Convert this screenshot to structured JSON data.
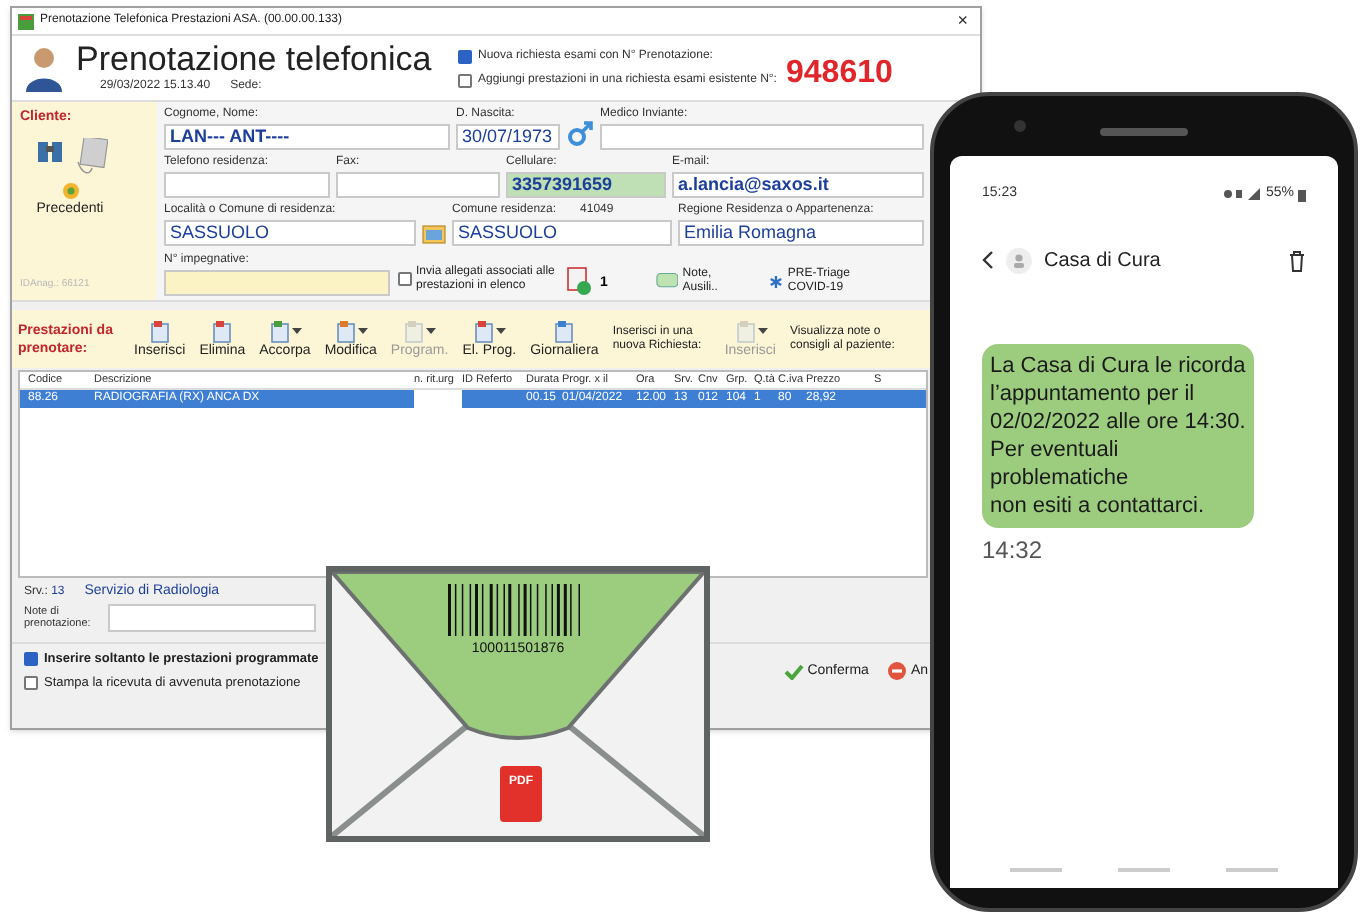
{
  "window": {
    "title": "Prenotazione Telefonica Prestazioni ASA. (00.00.00.133)",
    "close": "×"
  },
  "header": {
    "title": "Prenotazione telefonica",
    "datetime": "29/03/2022 15.13.40",
    "sede_label": "Sede:",
    "options": [
      {
        "label": "Nuova richiesta esami con N° Prenotazione:",
        "checked": true
      },
      {
        "label": "Aggiungi prestazioni in una richiesta esami esistente N°:",
        "checked": false
      }
    ],
    "number": "948610"
  },
  "client": {
    "label": "Cliente:",
    "history_label": "Precedenti",
    "id_label": "IDAnag.: 66121",
    "fields": [
      {
        "label": "Cognome, Nome:",
        "value": "LAN--- ANT----",
        "kind": "bold"
      },
      {
        "label": "D. Nascita:",
        "value": "30/07/1973",
        "kind": "plain"
      },
      {
        "label": "Medico Inviante:",
        "kind": "plain"
      },
      {
        "label": "Telefono residenza:",
        "kind": "plain"
      },
      {
        "label": "Fax:",
        "kind": "plain"
      },
      {
        "label": "Cellulare:",
        "value": "3357391659",
        "kind": "highlight"
      },
      {
        "label": "E-mail:",
        "value": "a.lancia@saxos.it",
        "kind": "bold"
      },
      {
        "label": "Località o Comune di residenza:",
        "value": "SASSUOLO",
        "kind": "plain"
      },
      {
        "label": "Comune residenza:",
        "code": "41049",
        "value": "SASSUOLO",
        "kind": "plain"
      },
      {
        "label": "Regione Residenza o Appartenenza:",
        "value": "Emilia Romagna",
        "kind": "plain"
      },
      {
        "label": "N° impegnative:",
        "kind": "required"
      }
    ],
    "attach": {
      "label": "Invia allegati associati alle prestazioni in elenco",
      "checked": false,
      "count": "1"
    },
    "notes_button": "Note, Ausili..",
    "triage_button": "PRE-Triage COVID-19"
  },
  "toolbar": {
    "label": "Prestazioni da prenotare:",
    "buttons": [
      {
        "label": "Inserisci",
        "disabled": false,
        "dropdown": false
      },
      {
        "label": "Elimina",
        "disabled": false,
        "dropdown": false
      },
      {
        "label": "Accorpa",
        "disabled": false,
        "dropdown": true
      },
      {
        "label": "Modifica",
        "disabled": false,
        "dropdown": true
      },
      {
        "label": "Program.",
        "disabled": true,
        "dropdown": true
      },
      {
        "label": "El. Prog.",
        "disabled": false,
        "dropdown": true
      },
      {
        "label": "Giornaliera",
        "disabled": false,
        "dropdown": false
      }
    ],
    "new_request_label": "Inserisci in una nuova Richiesta:",
    "new_request_button": {
      "label": "Inserisci",
      "disabled": true,
      "dropdown": true
    },
    "advice_label": "Visualizza note o consigli al paziente:"
  },
  "table": {
    "columns": [
      "Codice",
      "Descrizione",
      "n. rit.",
      "urg",
      "ID Referto",
      "Durata",
      "Progr. x il",
      "Ora",
      "Srv.",
      "Cnv",
      "Grp.",
      "Q.tà",
      "C.iva",
      "Prezzo",
      "S"
    ],
    "rows": [
      {
        "selected": true,
        "cells": [
          "88.26",
          "RADIOGRAFIA (RX) ANCA DX",
          null,
          null,
          null,
          "00.15",
          "01/04/2022",
          "12.00",
          "13",
          "012",
          "104",
          "1",
          "80",
          "28,92",
          null
        ]
      }
    ]
  },
  "service": {
    "label": "Srv.:",
    "code": "13",
    "name": "Servizio di Radiologia"
  },
  "booking_notes": {
    "label": "Note di prenotazione:"
  },
  "footer": {
    "options": [
      {
        "label": "Inserire soltanto le prestazioni programmate",
        "checked": true
      },
      {
        "label": "Stampa la ricevuta di avvenuta prenotazione",
        "checked": false
      }
    ],
    "confirm": "Conferma",
    "cancel": "An"
  },
  "envelope": {
    "barcode_number": "100011501876",
    "attachment": "PDF"
  },
  "phone": {
    "time": "15:23",
    "battery": "55%",
    "contact": "Casa di Cura",
    "message": "La Casa di Cura le ricorda\nl’appuntamento per il\n02/02/2022 alle ore 14:30.\nPer eventuali\nproblematiche\nnon esiti a contattarci.",
    "message_time": "14:32"
  }
}
